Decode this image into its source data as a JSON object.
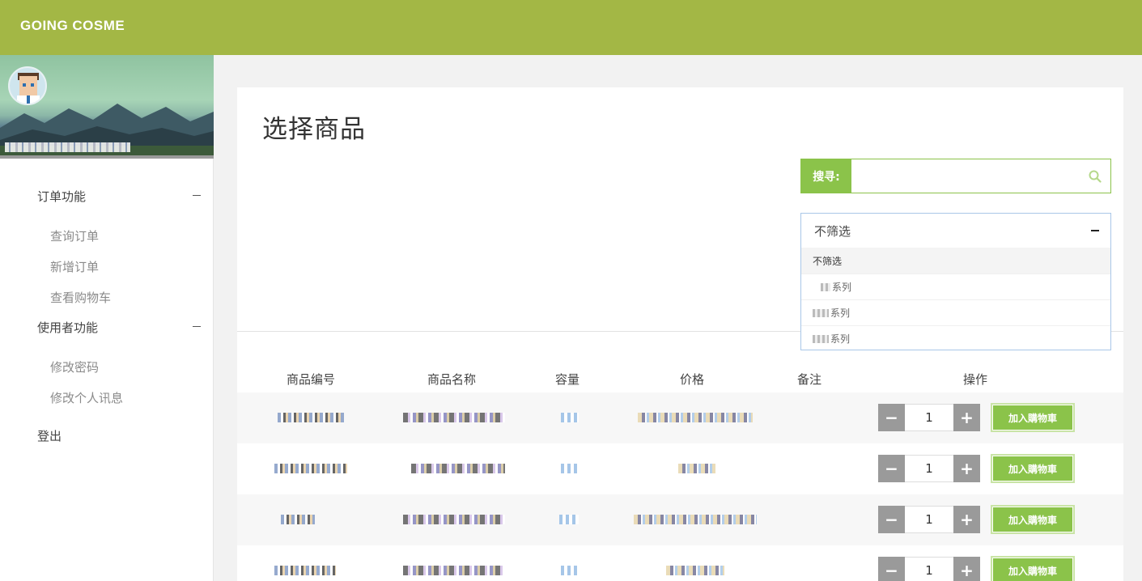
{
  "header": {
    "brand": "GOING COSME"
  },
  "sidebar": {
    "groups": [
      {
        "label": "订单功能",
        "items": [
          "查询订单",
          "新增订单",
          "查看购物车"
        ]
      },
      {
        "label": "使用者功能",
        "items": [
          "修改密码",
          "修改个人讯息"
        ]
      }
    ],
    "logout": "登出"
  },
  "main": {
    "title": "选择商品",
    "search": {
      "label": "搜寻:",
      "value": "",
      "placeholder": ""
    },
    "filter": {
      "selected": "不筛选",
      "options": [
        "不筛选",
        "系列",
        "系列",
        "系列"
      ]
    },
    "table": {
      "headers": [
        "商品编号",
        "商品名称",
        "容量",
        "价格",
        "备注",
        "操作"
      ],
      "rows": [
        {
          "qty": "1",
          "button": "加入購物車"
        },
        {
          "qty": "1",
          "button": "加入購物車"
        },
        {
          "qty": "1",
          "button": "加入購物車"
        },
        {
          "qty": "1",
          "button": "加入購物車"
        }
      ]
    }
  },
  "colors": {
    "header_bg": "#a3b745",
    "accent": "#8bc34a",
    "stepper_bg": "#9a9a9a"
  }
}
